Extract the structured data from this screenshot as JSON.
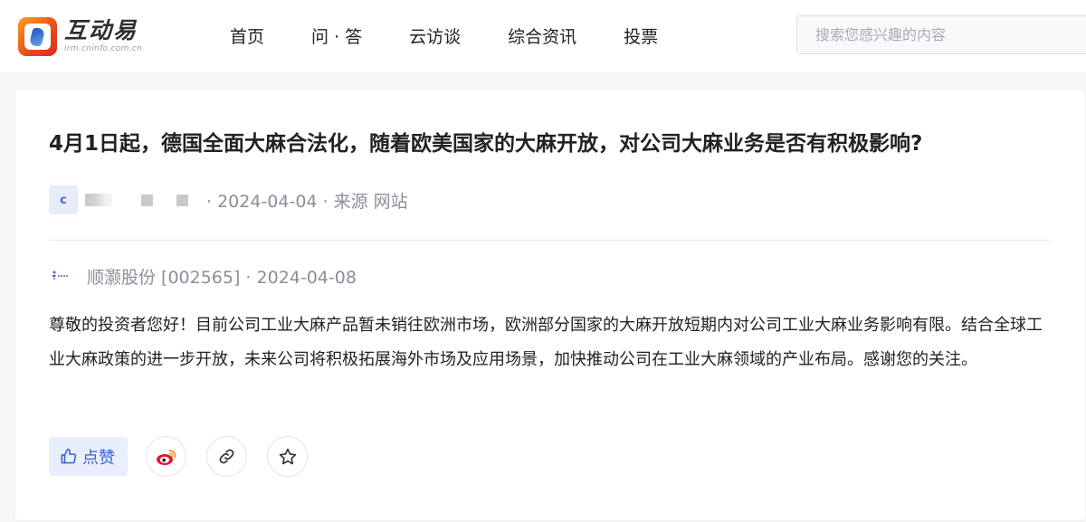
{
  "header": {
    "logo_name": "互动易",
    "logo_url": "irm.cninfo.com.cn",
    "nav": [
      "首页",
      "问 · 答",
      "云访谈",
      "综合资讯",
      "投票"
    ],
    "search_placeholder": "搜索您感兴趣的内容"
  },
  "question": {
    "title": "4月1日起，德国全面大麻合法化，随着欧美国家的大麻开放，对公司大麻业务是否有积极影响?",
    "asker_initial": "c",
    "asker_meta": "· 2024-04-04 · 来源 网站"
  },
  "answer": {
    "company_meta": "顺灏股份 [002565] · 2024-04-08",
    "body": "尊敬的投资者您好！目前公司工业大麻产品暂未销往欧洲市场，欧洲部分国家的大麻开放短期内对公司工业大麻业务影响有限。结合全球工业大麻政策的进一步开放，未来公司将积极拓展海外市场及应用场景，加快推动公司在工业大麻领域的产业布局。感谢您的关注。"
  },
  "actions": {
    "like_label": "点赞",
    "icons": [
      "thumbs-up-icon",
      "weibo-icon",
      "link-icon",
      "star-icon"
    ]
  },
  "colors": {
    "accent": "#3a62cf",
    "like_bg": "#e8eefc",
    "meta_text": "#8a8f99",
    "logo_orange": "#e8471d",
    "weibo_red": "#e6162d"
  }
}
